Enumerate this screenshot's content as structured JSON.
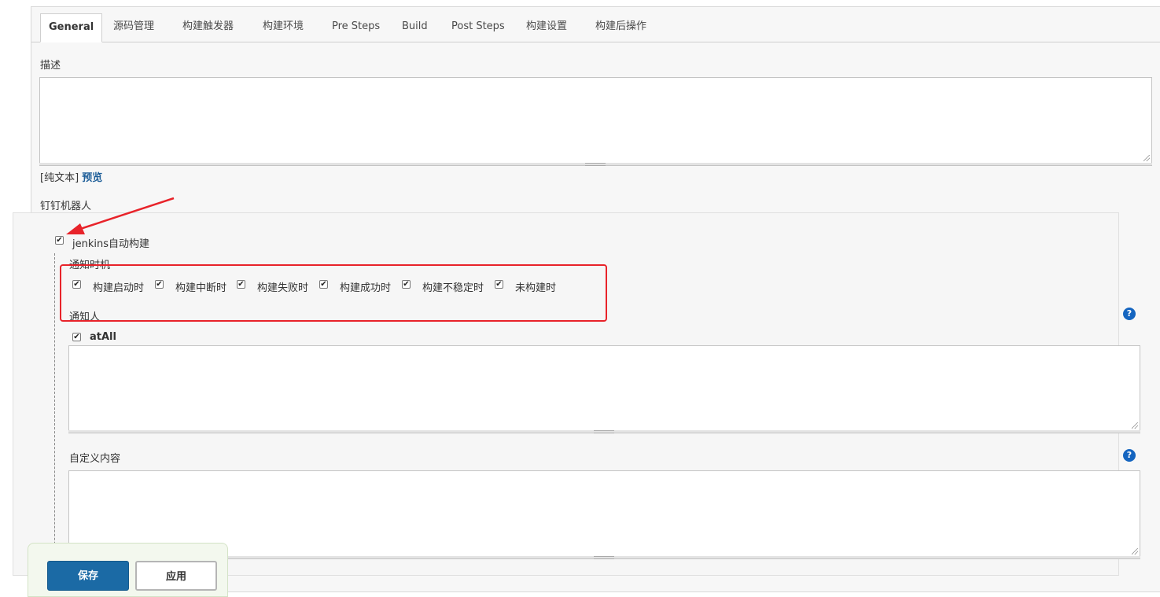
{
  "tabs": [
    "General",
    "源码管理",
    "构建触发器",
    "构建环境",
    "Pre Steps",
    "Build",
    "Post Steps",
    "构建设置",
    "构建后操作"
  ],
  "description": {
    "label": "描述",
    "value": "",
    "format_prefix": "[纯文本]",
    "preview_link": "预览"
  },
  "dingtalk": {
    "section_label": "钉钉机器人",
    "enable_label": "jenkins自动构建",
    "enable_checked": true,
    "notify_timing_label": "通知时机",
    "timings": [
      {
        "label": "构建启动时",
        "checked": true
      },
      {
        "label": "构建中断时",
        "checked": true
      },
      {
        "label": "构建失败时",
        "checked": true
      },
      {
        "label": "构建成功时",
        "checked": true
      },
      {
        "label": "构建不稳定时",
        "checked": true
      },
      {
        "label": "未构建时",
        "checked": true
      }
    ],
    "notify_people_label": "通知人",
    "at_all_label": "atAll",
    "at_all_checked": true,
    "notify_people_value": "",
    "custom_content_label": "自定义内容",
    "custom_content_value": "",
    "help_icon": "?"
  },
  "footer": {
    "save_label": "保存",
    "apply_label": "应用"
  },
  "colors": {
    "primary_button": "#1b6aa5",
    "annotation_red": "#e8232a",
    "help_icon": "#1565c0",
    "link": "#1f5f99"
  },
  "checkmark": "✔"
}
